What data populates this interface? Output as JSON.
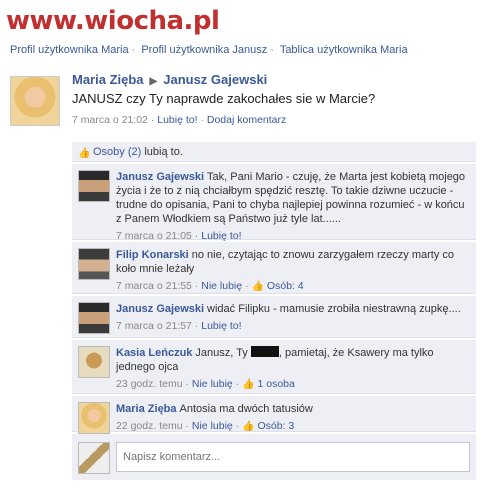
{
  "watermark": "www.wiocha.pl",
  "breadcrumbs": [
    "Profil użytkownika Maria",
    "Profil użytkownika Janusz",
    "Tablica użytkownika Maria"
  ],
  "post": {
    "author": "Maria Zięba",
    "target": "Janusz Gajewski",
    "text": "JANUSZ czy Ty naprawde zakochałes sie w Marcie?",
    "time": "7 marca o 21:02",
    "like_label": "Lubię to!",
    "comment_label": "Dodaj komentarz"
  },
  "likes": {
    "prefix": "Osoby (2)",
    "suffix": "lubią to."
  },
  "comments": [
    {
      "author": "Janusz Gajewski",
      "text": "Tak, Pani Mario - czuję, że Marta jest kobietą mojego życia i że to z nią chciałbym spędzić resztę. To takie dziwne uczucie - trudne do opisania, Pani to chyba najlepiej powinna rozumieć - w końcu z Panem Włodkiem są Państwo już tyle lat......",
      "time": "7 marca o 21:05",
      "action": "Lubię to!",
      "count": ""
    },
    {
      "author": "Filip Konarski",
      "text": "no nie, czytając to znowu zarzygałem rzeczy marty co koło mnie leżały",
      "time": "7 marca o 21:55",
      "action": "Nie lubię",
      "count": "Osób: 4"
    },
    {
      "author": "Janusz Gajewski",
      "text": "widać Filipku - mamusie zrobiła niestrawną zupkę....",
      "time": "7 marca o 21:57",
      "action": "Lubię to!",
      "count": ""
    },
    {
      "author": "Kasia Leńczuk",
      "text_before": "Janusz, Ty",
      "text_after": ", pamietaj, że Ksawery ma tylko jednego ojca",
      "time": "23 godz. temu",
      "action": "Nie lubię",
      "count": "1 osoba"
    },
    {
      "author": "Maria Zięba",
      "text": "Antosia ma dwóch tatusiów",
      "time": "22 godz. temu",
      "action": "Nie lubię",
      "count": "Osób: 3"
    }
  ],
  "reply": {
    "placeholder": "Napisz komentarz..."
  },
  "colors": {
    "link": "#3b5998",
    "comment_bg": "#edeff4",
    "watermark": "#c03030"
  },
  "icons": {
    "like": "thumbs-up-icon"
  }
}
